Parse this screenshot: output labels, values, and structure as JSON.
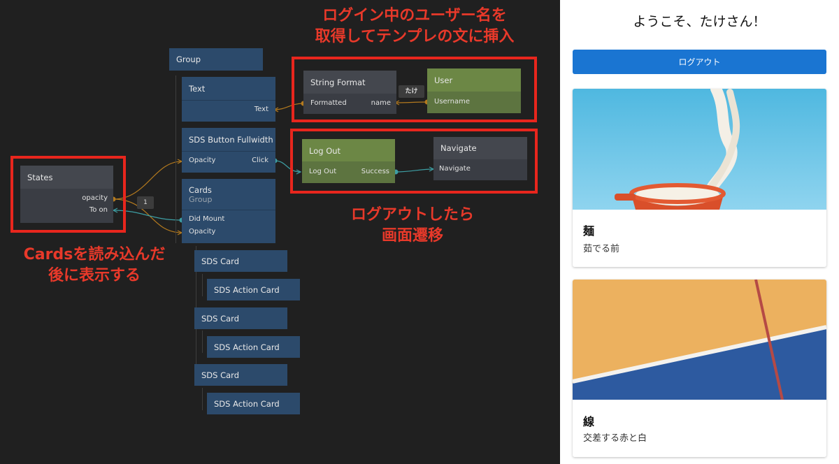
{
  "editor": {
    "nodes": {
      "group": {
        "title": "Group"
      },
      "text": {
        "title": "Text",
        "port_text": "Text"
      },
      "sds_button": {
        "title": "SDS Button Fullwidth",
        "port_opacity": "Opacity",
        "port_click": "Click"
      },
      "cards": {
        "title": "Cards",
        "subtitle": "Group",
        "port_did_mount": "Did Mount",
        "port_opacity": "Opacity"
      },
      "states": {
        "title": "States",
        "port_opacity": "opacity",
        "port_to_on": "To on"
      },
      "string_format": {
        "title": "String Format",
        "port_formatted": "Formatted",
        "port_name": "name"
      },
      "user": {
        "title": "User",
        "port_username": "Username"
      },
      "logout": {
        "title": "Log Out",
        "port_logout": "Log Out",
        "port_success": "Success"
      },
      "navigate": {
        "title": "Navigate",
        "port_navigate": "Navigate"
      },
      "sds_card_1": {
        "title": "SDS Card"
      },
      "sds_action_card_1": {
        "title": "SDS Action Card"
      },
      "sds_card_2": {
        "title": "SDS Card"
      },
      "sds_action_card_2": {
        "title": "SDS Action Card"
      },
      "sds_card_3": {
        "title": "SDS Card"
      },
      "sds_action_card_3": {
        "title": "SDS Action Card"
      }
    },
    "badges": {
      "wire_value_name": "たけ",
      "wire_value_one": "1"
    },
    "annotations": {
      "username_line1": "ログイン中のユーザー名を",
      "username_line2": "取得してテンプレの文に挿入",
      "logout_line1": "ログアウトしたら",
      "logout_line2": "画面遷移",
      "cards_line1": "Cardsを読み込んだ",
      "cards_line2": "後に表示する"
    },
    "colors": {
      "annotation_red": "#e8261d",
      "node_blue": "#2c4a6b",
      "node_green": "#6c8745",
      "wire_orange": "#b47a1e",
      "wire_teal": "#3d9ea3"
    }
  },
  "preview": {
    "welcome": "ようこそ、たけさん！",
    "logout_button": "ログアウト",
    "cards": [
      {
        "title": "麺",
        "description": "茹でる前"
      },
      {
        "title": "線",
        "description": "交差する赤と白"
      }
    ],
    "colors": {
      "button_blue": "#1a75d2"
    }
  }
}
